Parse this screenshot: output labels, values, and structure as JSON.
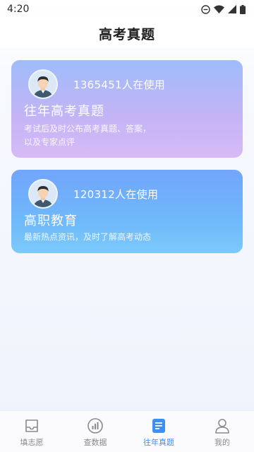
{
  "status_bar": {
    "time": "4:20",
    "icons": [
      "do-not-disturb-icon",
      "wifi-icon",
      "signal-icon",
      "battery-icon"
    ]
  },
  "header": {
    "title": "高考真题"
  },
  "cards": [
    {
      "usage": "1365451人在使用",
      "title": "往年高考真题",
      "desc_line1": "考试后及时公布高考真题、答案，",
      "desc_line2": "以及专家点评"
    },
    {
      "usage": "120312人在使用",
      "title": "高职教育",
      "desc_line1": "最新热点资讯，及时了解高考动态"
    }
  ],
  "tabbar": {
    "items": [
      {
        "label": "填志愿",
        "icon": "inbox-icon",
        "active": false
      },
      {
        "label": "查数据",
        "icon": "chart-icon",
        "active": false
      },
      {
        "label": "往年真题",
        "icon": "document-icon",
        "active": true
      },
      {
        "label": "我的",
        "icon": "user-icon",
        "active": false
      }
    ]
  },
  "colors": {
    "accent": "#3d8ef5",
    "inactive": "#8a8a8a"
  }
}
